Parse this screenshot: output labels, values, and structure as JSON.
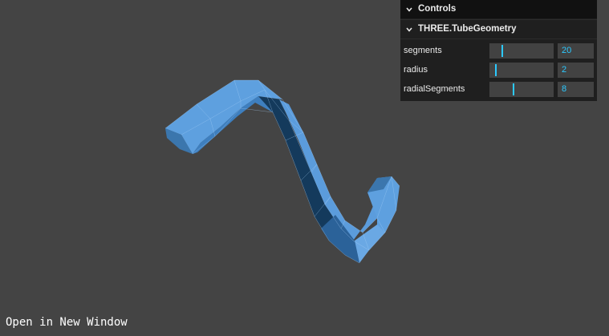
{
  "gui": {
    "title": "Controls",
    "folder": "THREE.TubeGeometry",
    "controls": [
      {
        "label": "segments",
        "value": "20",
        "fraction": 0.19
      },
      {
        "label": "radius",
        "value": "2",
        "fraction": 0.09
      },
      {
        "label": "radialSegments",
        "value": "8",
        "fraction": 0.37
      }
    ]
  },
  "footer": {
    "link": "Open in New Window"
  },
  "colors": {
    "background": "#444444",
    "mesh": "#4a8fd1",
    "accent": "#2cc9ff"
  },
  "icons": {
    "collapse": "chevron-down-icon"
  }
}
